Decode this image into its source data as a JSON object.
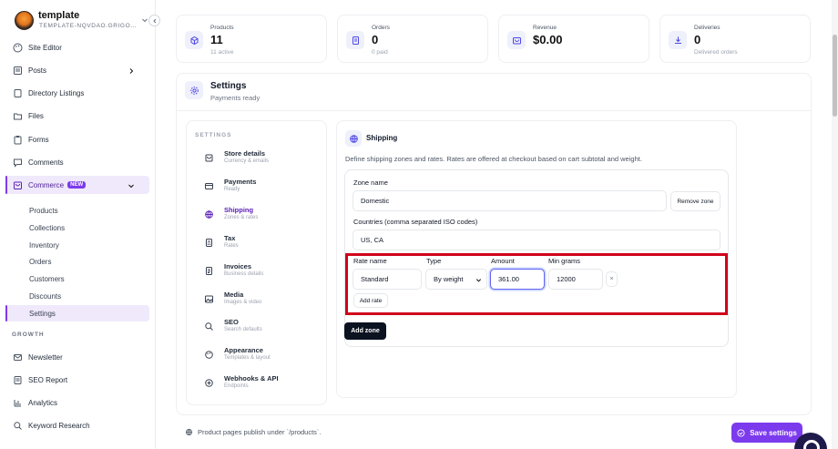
{
  "brand": {
    "name": "template",
    "subtitle": "TEMPLATE-NQVDAO.GRIGORIOS..."
  },
  "sidebar": {
    "items": [
      {
        "label": "Site Editor",
        "icon": "palette-icon"
      },
      {
        "label": "Posts",
        "icon": "posts-icon"
      },
      {
        "label": "Directory Listings",
        "icon": "book-icon"
      },
      {
        "label": "Files",
        "icon": "folder-icon"
      },
      {
        "label": "Forms",
        "icon": "clipboard-icon"
      },
      {
        "label": "Comments",
        "icon": "comment-icon"
      },
      {
        "label": "Commerce",
        "icon": "bag-icon",
        "badge": "NEW"
      }
    ],
    "commerce_sub": [
      "Products",
      "Collections",
      "Inventory",
      "Orders",
      "Customers",
      "Discounts",
      "Settings"
    ],
    "growth_label": "GROWTH",
    "growth_items": [
      {
        "label": "Newsletter",
        "icon": "mail-icon"
      },
      {
        "label": "SEO Report",
        "icon": "report-icon"
      },
      {
        "label": "Analytics",
        "icon": "chart-icon"
      },
      {
        "label": "Keyword Research",
        "icon": "search-icon"
      }
    ]
  },
  "stats": [
    {
      "label": "Products",
      "value": "11",
      "sub": "11 active",
      "icon": "box-icon"
    },
    {
      "label": "Orders",
      "value": "0",
      "sub": "0 paid",
      "icon": "receipt-icon"
    },
    {
      "label": "Revenue",
      "value": "$0.00",
      "sub": "",
      "icon": "wallet-icon"
    },
    {
      "label": "Deliveries",
      "value": "0",
      "sub": "Delivered orders",
      "icon": "download-icon"
    }
  ],
  "settings": {
    "title": "Settings",
    "subtitle": "Payments ready"
  },
  "settings_nav": {
    "label": "SETTINGS",
    "items": [
      {
        "title": "Store details",
        "desc": "Currency & emails"
      },
      {
        "title": "Payments",
        "desc": "Ready"
      },
      {
        "title": "Shipping",
        "desc": "Zones & rates"
      },
      {
        "title": "Tax",
        "desc": "Rates"
      },
      {
        "title": "Invoices",
        "desc": "Business details"
      },
      {
        "title": "Media",
        "desc": "Images & video"
      },
      {
        "title": "SEO",
        "desc": "Search defaults"
      },
      {
        "title": "Appearance",
        "desc": "Templates & layout"
      },
      {
        "title": "Webhooks & API",
        "desc": "Endpoints"
      }
    ]
  },
  "shipping": {
    "title": "Shipping",
    "description": "Define shipping zones and rates. Rates are offered at checkout based on cart subtotal and weight.",
    "zone_name_label": "Zone name",
    "zone_name_value": "Domestic",
    "remove_zone": "Remove zone",
    "countries_label": "Countries (comma separated ISO codes)",
    "countries_value": "US, CA",
    "rate_name_label": "Rate name",
    "type_label": "Type",
    "amount_label": "Amount",
    "min_grams_label": "Min grams",
    "rate_name_value": "Standard",
    "type_value": "By weight",
    "amount_value": "361.00",
    "min_grams_value": "12000",
    "remove_rate": "×",
    "add_rate": "Add rate",
    "add_zone": "Add zone"
  },
  "footer": {
    "note": "Product pages publish under `/products`.",
    "save": "Save settings"
  },
  "colors": {
    "accent": "#7c3aed",
    "highlight": "#d0021b",
    "dark": "#0b1220"
  }
}
